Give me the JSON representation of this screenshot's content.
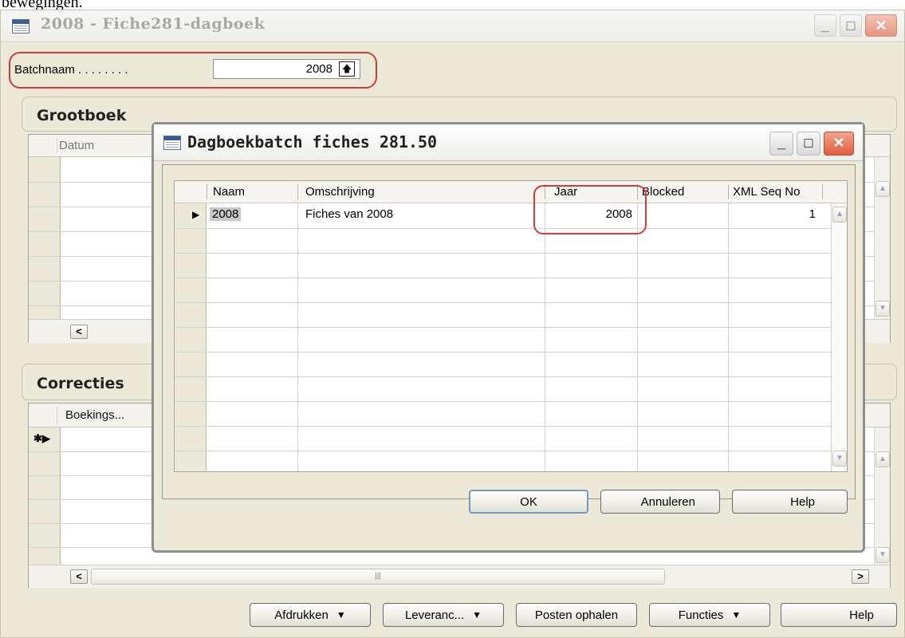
{
  "top_fragment": "bewegingen.",
  "main_window": {
    "title": "2008 - Fiche281-dagboek",
    "batch_label": "Batchnaam . . . . . . . .",
    "batch_value": "2008",
    "section_grootboek": "Grootboek",
    "grootboek_col_datum": "Datum",
    "section_correcties": "Correcties",
    "correcties_col_boekings": "Boekings...",
    "new_row_marker": "✱▶",
    "scroll_label": "|||",
    "buttons": {
      "afdrukken": "Afdrukken",
      "leveranc": "Leveranc...",
      "posten_ophalen": "Posten ophalen",
      "functies": "Functies",
      "help": "Help"
    }
  },
  "dialog": {
    "title": "Dagboekbatch fiches 281.50",
    "columns": [
      "Naam",
      "Omschrijving",
      "Jaar",
      "Blocked",
      "XML Seq No"
    ],
    "rows": [
      {
        "naam": "2008",
        "omschrijving": "Fiches van 2008",
        "jaar": "2008",
        "blocked": "",
        "xml_seq_no": "1"
      }
    ],
    "buttons": {
      "ok": "OK",
      "annuleren": "Annuleren",
      "help": "Help"
    }
  },
  "icons": {
    "minimize": "minimize-icon",
    "maximize": "maximize-icon",
    "close": "close-icon",
    "lookup": "lookup-arrow-icon",
    "dropdown": "chevron-down-icon",
    "row_pointer": "row-pointer-icon"
  }
}
